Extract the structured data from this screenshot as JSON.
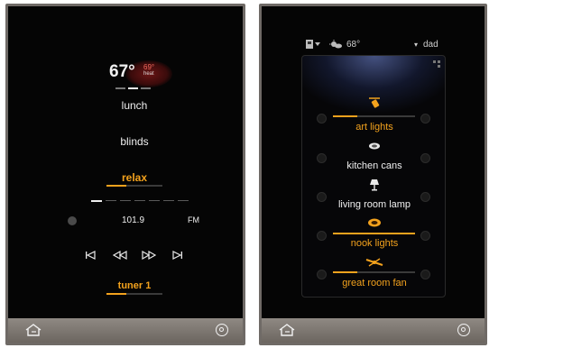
{
  "left": {
    "temperature": "67°",
    "temp_setpoint": "69°",
    "temp_setpoint_label": "heat",
    "scenes": [
      {
        "label": "lunch",
        "active": false
      },
      {
        "label": "blinds",
        "active": false
      },
      {
        "label": "relax",
        "active": true
      }
    ],
    "relax_level": 0.35,
    "frequency": "101.9",
    "band": "FM",
    "source": "tuner 1",
    "source_level": 0.35
  },
  "right": {
    "header_temp": "68°",
    "user": "dad",
    "lights": [
      {
        "label": "art lights",
        "on": true,
        "level": 0.3,
        "icon": "track-light-icon"
      },
      {
        "label": "kitchen cans",
        "on": false,
        "level": 0,
        "icon": "can-light-icon"
      },
      {
        "label": "living room lamp",
        "on": false,
        "level": 0,
        "icon": "lamp-icon"
      },
      {
        "label": "nook lights",
        "on": true,
        "level": 1.0,
        "icon": "pendant-icon"
      },
      {
        "label": "great room fan",
        "on": true,
        "level": 0.3,
        "icon": "fan-icon"
      }
    ]
  },
  "colors": {
    "accent": "#f3a21d",
    "panel": "#050505",
    "bezel": "#6f6a66"
  }
}
